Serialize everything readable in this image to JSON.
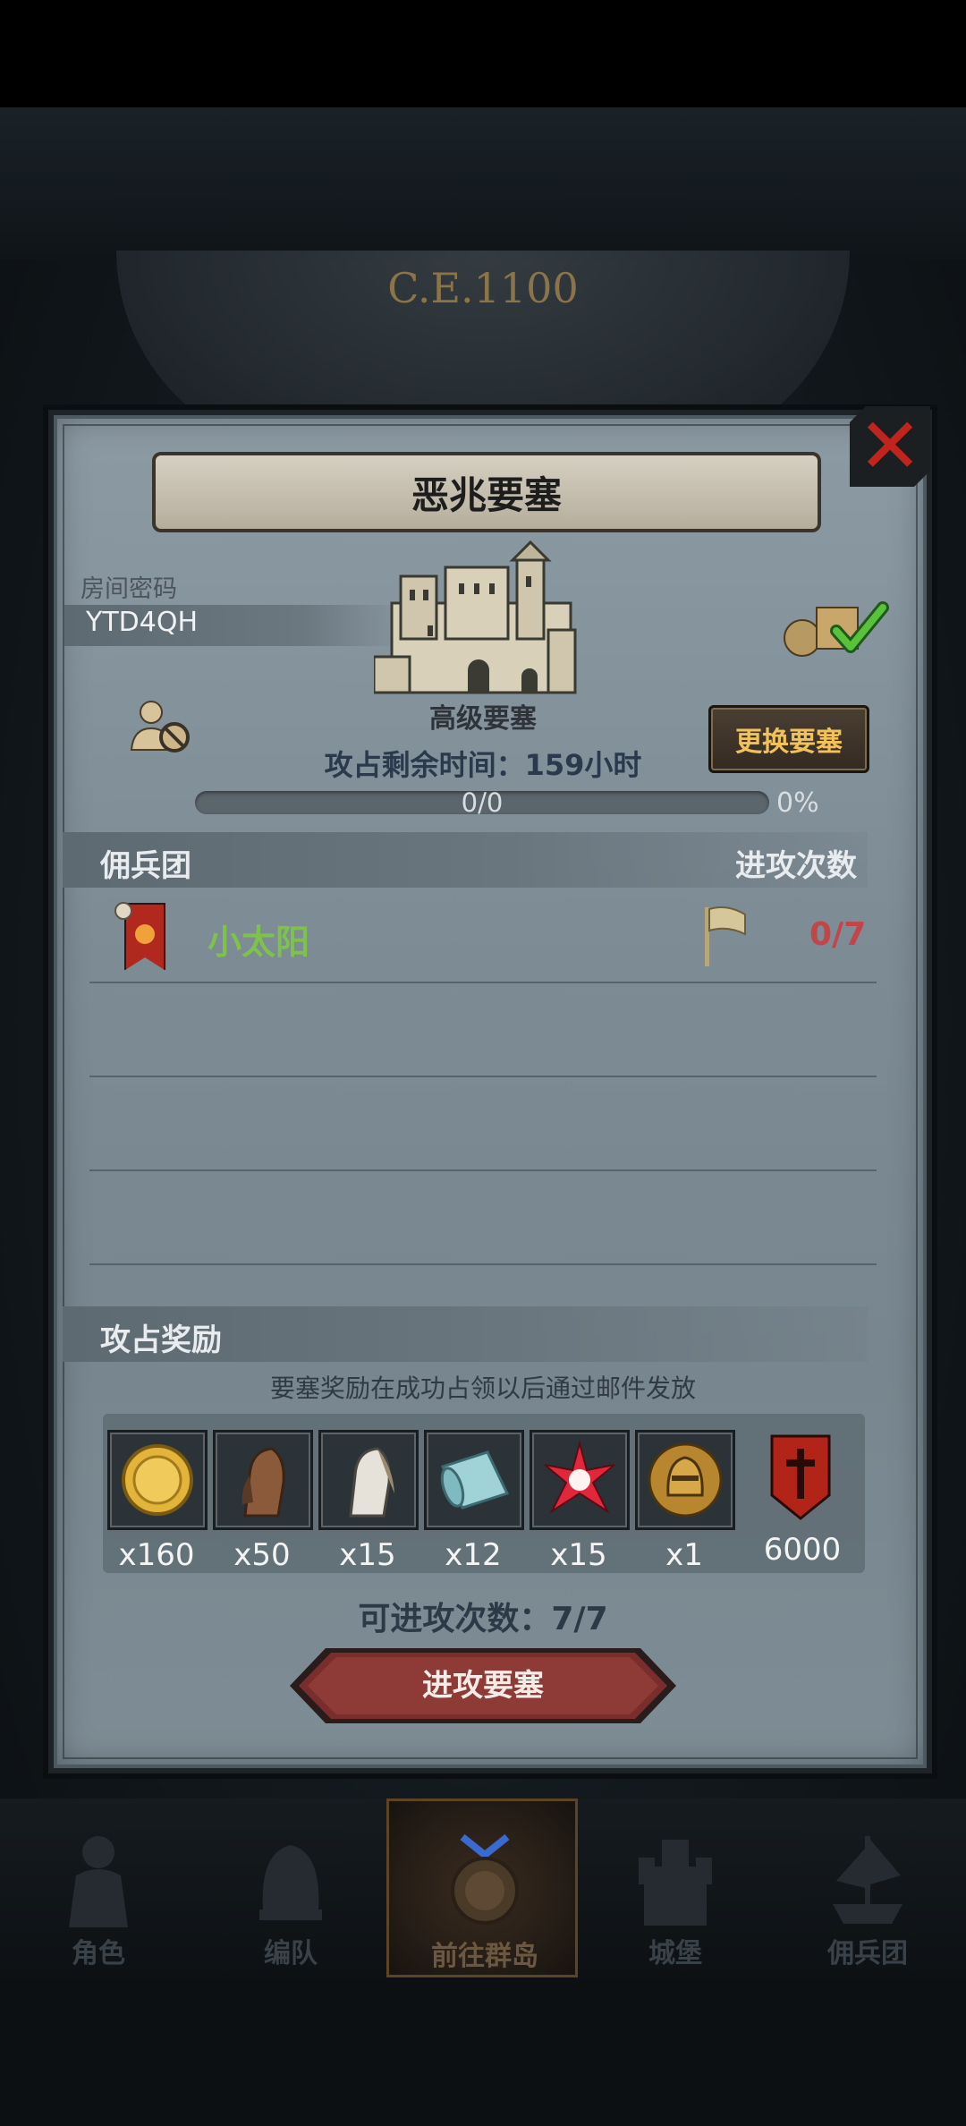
{
  "background": {
    "era_text": "C.E.1100"
  },
  "dialog": {
    "title": "恶兆要塞",
    "room_label": "房间密码",
    "room_code": "YTD4QH",
    "castle_name": "高级要塞",
    "time_remaining": "攻占剩余时间：159小时",
    "change_button": "更换要塞",
    "progress": {
      "text": "0/0",
      "percent_text": "0%",
      "value": 0
    },
    "mercenary_header": "佣兵团",
    "attacks_header": "进攻次数",
    "guild_rows": [
      {
        "name": "小太阳",
        "count": "0/7"
      }
    ],
    "reward_header": "攻占奖励",
    "reward_note": "要塞奖励在成功占领以后通过邮件发放",
    "rewards": [
      {
        "icon": "gold-coin-icon",
        "qty": "x160"
      },
      {
        "icon": "brown-horse-icon",
        "qty": "x50"
      },
      {
        "icon": "white-horse-icon",
        "qty": "x15"
      },
      {
        "icon": "cloth-roll-icon",
        "qty": "x12"
      },
      {
        "icon": "red-crystal-icon",
        "qty": "x15"
      },
      {
        "icon": "knight-helmet-medal-icon",
        "qty": "x1"
      },
      {
        "icon": "guild-banner-icon",
        "qty": "6000"
      }
    ],
    "attack_times": "可进攻次数：7/7",
    "attack_button": "进攻要塞"
  },
  "nav": [
    {
      "label": "角色",
      "icon": "knight-icon"
    },
    {
      "label": "编队",
      "icon": "helmet-icon"
    },
    {
      "label": "前往群岛",
      "icon": "compass-icon",
      "active": true
    },
    {
      "label": "城堡",
      "icon": "castle-icon"
    },
    {
      "label": "佣兵团",
      "icon": "ship-icon"
    }
  ],
  "colors": {
    "guild_name": "#7ec24a",
    "attack_count": "#c2454a",
    "change_button_text": "#f2c25a",
    "close_x": "#c0241c"
  }
}
